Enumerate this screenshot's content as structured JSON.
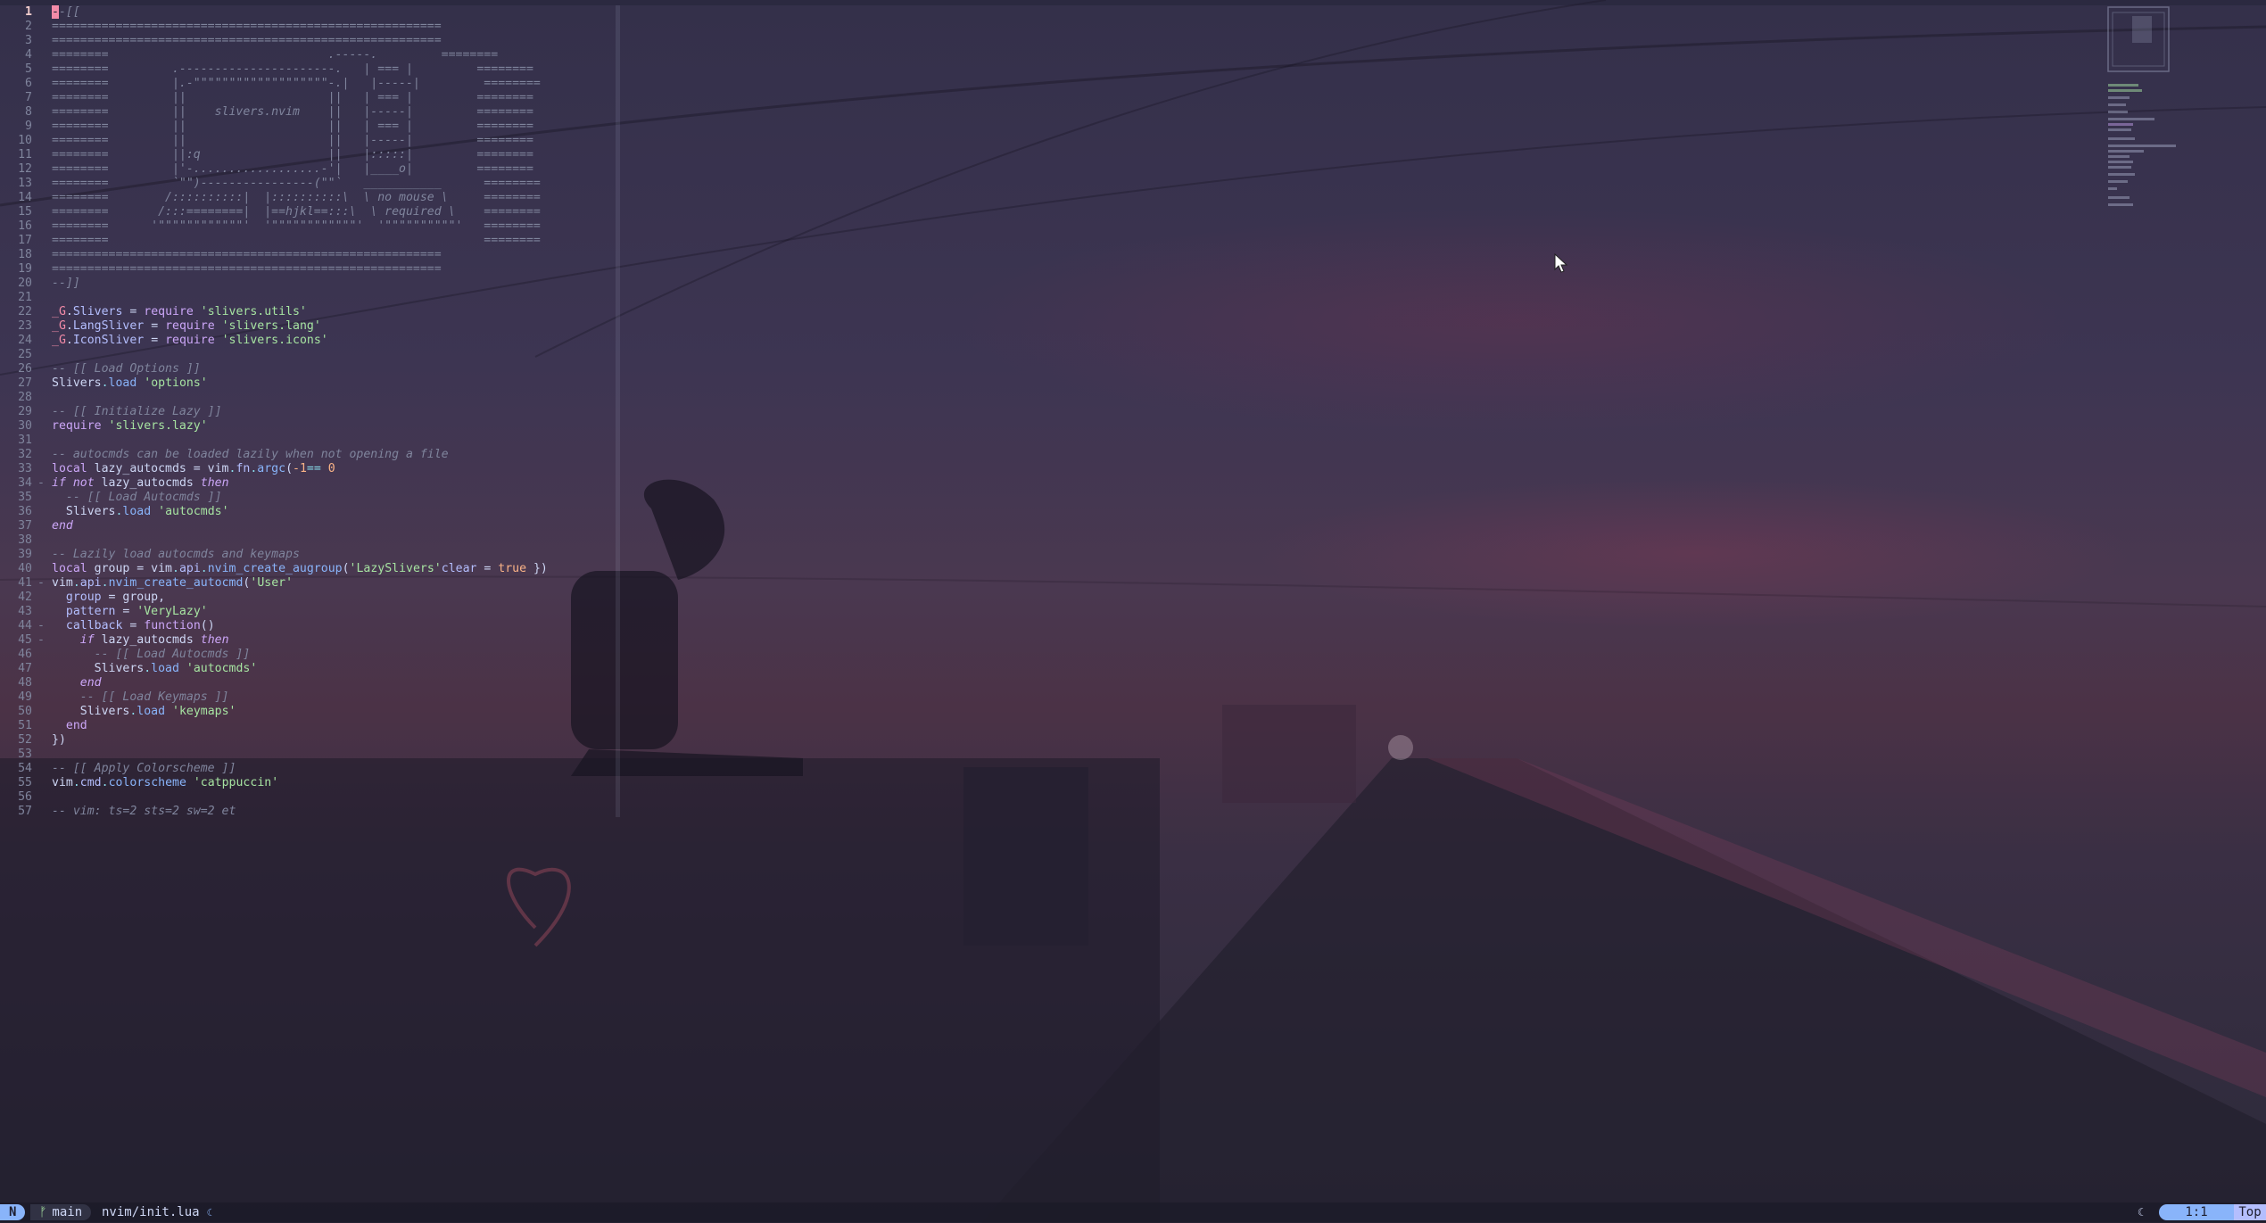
{
  "editor": {
    "lines": [
      {
        "n": "1",
        "segs": [
          [
            "cursor",
            "-"
          ],
          [
            "c-comment",
            "-[["
          ]
        ],
        "cur": true
      },
      {
        "n": "2",
        "segs": [
          [
            "c-comment",
            "======================================================="
          ]
        ]
      },
      {
        "n": "3",
        "segs": [
          [
            "c-comment",
            "======================================================="
          ]
        ]
      },
      {
        "n": "4",
        "segs": [
          [
            "c-comment",
            "========                               .-----.         ========"
          ]
        ]
      },
      {
        "n": "5",
        "segs": [
          [
            "c-comment",
            "========         .----------------------.   | === |         ========"
          ]
        ]
      },
      {
        "n": "6",
        "segs": [
          [
            "c-comment",
            "========         |.-\"\"\"\"\"\"\"\"\"\"\"\"\"\"\"\"\"\"\"-.|   |-----|         ========"
          ]
        ]
      },
      {
        "n": "7",
        "segs": [
          [
            "c-comment",
            "========         ||                    ||   | === |         ========"
          ]
        ]
      },
      {
        "n": "8",
        "segs": [
          [
            "c-comment",
            "========         ||    slivers.nvim    ||   |-----|         ========"
          ]
        ]
      },
      {
        "n": "9",
        "segs": [
          [
            "c-comment",
            "========         ||                    ||   | === |         ========"
          ]
        ]
      },
      {
        "n": "10",
        "segs": [
          [
            "c-comment",
            "========         ||                    ||   |-----|         ========"
          ]
        ]
      },
      {
        "n": "11",
        "segs": [
          [
            "c-comment",
            "========         ||:q                  ||   |:::::|         ========"
          ]
        ]
      },
      {
        "n": "12",
        "segs": [
          [
            "c-comment",
            "========         |'-..................-'|   |____o|         ========"
          ]
        ]
      },
      {
        "n": "13",
        "segs": [
          [
            "c-comment",
            "========         `\"\")----------------(\"\"`   ___________      ========"
          ]
        ]
      },
      {
        "n": "14",
        "segs": [
          [
            "c-comment",
            "========        /::::::::::|  |::::::::::\\  \\ no mouse \\     ========"
          ]
        ]
      },
      {
        "n": "15",
        "segs": [
          [
            "c-comment",
            "========       /:::========|  |==hjkl==:::\\  \\ required \\    ========"
          ]
        ]
      },
      {
        "n": "16",
        "segs": [
          [
            "c-comment",
            "========      '\"\"\"\"\"\"\"\"\"\"\"\"'  '\"\"\"\"\"\"\"\"\"\"\"\"'  '\"\"\"\"\"\"\"\"\"\"'   ========"
          ]
        ]
      },
      {
        "n": "17",
        "segs": [
          [
            "c-comment",
            "========                                                     ========"
          ]
        ]
      },
      {
        "n": "18",
        "segs": [
          [
            "c-comment",
            "======================================================="
          ]
        ]
      },
      {
        "n": "19",
        "segs": [
          [
            "c-comment",
            "======================================================="
          ]
        ]
      },
      {
        "n": "20",
        "segs": [
          [
            "c-comment",
            "--]]"
          ]
        ]
      },
      {
        "n": "21",
        "segs": []
      },
      {
        "n": "22",
        "segs": [
          [
            "c-g",
            "_G"
          ],
          [
            "",
            "."
          ],
          [
            "c-field",
            "Slivers"
          ],
          [
            "",
            " = "
          ],
          [
            "c-kw2",
            "require"
          ],
          [
            "",
            " "
          ],
          [
            "c-str",
            "'slivers.utils'"
          ]
        ]
      },
      {
        "n": "23",
        "segs": [
          [
            "c-g",
            "_G"
          ],
          [
            "",
            "."
          ],
          [
            "c-field",
            "LangSliver"
          ],
          [
            "",
            " = "
          ],
          [
            "c-kw2",
            "require"
          ],
          [
            "",
            " "
          ],
          [
            "c-str",
            "'slivers.lang'"
          ]
        ]
      },
      {
        "n": "24",
        "segs": [
          [
            "c-g",
            "_G"
          ],
          [
            "",
            "."
          ],
          [
            "c-field",
            "IconSliver"
          ],
          [
            "",
            " = "
          ],
          [
            "c-kw2",
            "require"
          ],
          [
            "",
            " "
          ],
          [
            "c-str",
            "'slivers.icons'"
          ]
        ]
      },
      {
        "n": "25",
        "segs": []
      },
      {
        "n": "26",
        "segs": [
          [
            "c-comment",
            "-- [[ Load Options ]]"
          ]
        ]
      },
      {
        "n": "27",
        "segs": [
          [
            "",
            "Slivers"
          ],
          [
            "c-op",
            "."
          ],
          [
            "c-fn",
            "load"
          ],
          [
            "",
            " "
          ],
          [
            "c-str",
            "'options'"
          ]
        ]
      },
      {
        "n": "28",
        "segs": []
      },
      {
        "n": "29",
        "segs": [
          [
            "c-comment",
            "-- [[ Initialize Lazy ]]"
          ]
        ]
      },
      {
        "n": "30",
        "segs": [
          [
            "c-kw2",
            "require"
          ],
          [
            "",
            " "
          ],
          [
            "c-str",
            "'slivers.lazy'"
          ]
        ]
      },
      {
        "n": "31",
        "segs": []
      },
      {
        "n": "32",
        "segs": [
          [
            "c-comment",
            "-- autocmds can be loaded lazily when not opening a file"
          ]
        ]
      },
      {
        "n": "33",
        "segs": [
          [
            "c-kw2",
            "local"
          ],
          [
            "",
            " lazy_autocmds = vim"
          ],
          [
            "c-op",
            "."
          ],
          [
            "c-field",
            "fn"
          ],
          [
            "c-op",
            "."
          ],
          [
            "c-fn",
            "argc"
          ],
          [
            "",
            "("
          ],
          [
            "c-num",
            "-1"
          ],
          [
            ") "
          ],
          [
            "c-op",
            "=="
          ],
          [
            "",
            " "
          ],
          [
            "c-num",
            "0"
          ]
        ]
      },
      {
        "n": "34",
        "fold": "-",
        "segs": [
          [
            "c-kw",
            "if"
          ],
          [
            "",
            " "
          ],
          [
            "c-kw",
            "not"
          ],
          [
            "",
            " lazy_autocmds "
          ],
          [
            "c-kw",
            "then"
          ]
        ]
      },
      {
        "n": "35",
        "segs": [
          [
            "",
            "  "
          ],
          [
            "c-comment",
            "-- [[ Load Autocmds ]]"
          ]
        ]
      },
      {
        "n": "36",
        "segs": [
          [
            "",
            "  Slivers"
          ],
          [
            "c-op",
            "."
          ],
          [
            "c-fn",
            "load"
          ],
          [
            "",
            " "
          ],
          [
            "c-str",
            "'autocmds'"
          ]
        ]
      },
      {
        "n": "37",
        "segs": [
          [
            "c-kw",
            "end"
          ]
        ]
      },
      {
        "n": "38",
        "segs": []
      },
      {
        "n": "39",
        "segs": [
          [
            "c-comment",
            "-- Lazily load autocmds and keymaps"
          ]
        ]
      },
      {
        "n": "40",
        "segs": [
          [
            "c-kw2",
            "local"
          ],
          [
            "",
            " group = vim"
          ],
          [
            "c-op",
            "."
          ],
          [
            "c-field",
            "api"
          ],
          [
            "c-op",
            "."
          ],
          [
            "c-fn",
            "nvim_create_augroup"
          ],
          [
            "",
            "("
          ],
          [
            "c-str",
            "'LazySlivers'"
          ],
          [
            ", { "
          ],
          [
            "c-field",
            "clear"
          ],
          [
            "",
            " = "
          ],
          [
            "c-bool",
            "true"
          ],
          [
            "",
            " })"
          ]
        ]
      },
      {
        "n": "41",
        "fold": "-",
        "segs": [
          [
            "",
            "vim"
          ],
          [
            "c-op",
            "."
          ],
          [
            "c-field",
            "api"
          ],
          [
            "c-op",
            "."
          ],
          [
            "c-fn",
            "nvim_create_autocmd"
          ],
          [
            "",
            "("
          ],
          [
            "c-str",
            "'User'"
          ],
          [
            ", {"
          ]
        ]
      },
      {
        "n": "42",
        "segs": [
          [
            "",
            "  "
          ],
          [
            "c-field",
            "group"
          ],
          [
            "",
            " = group,"
          ]
        ]
      },
      {
        "n": "43",
        "segs": [
          [
            "",
            "  "
          ],
          [
            "c-field",
            "pattern"
          ],
          [
            "",
            " = "
          ],
          [
            "c-str",
            "'VeryLazy'"
          ],
          [
            ","
          ]
        ]
      },
      {
        "n": "44",
        "fold": "-",
        "segs": [
          [
            "",
            "  "
          ],
          [
            "c-field",
            "callback"
          ],
          [
            "",
            " = "
          ],
          [
            "c-kw2",
            "function"
          ],
          [
            "",
            "()"
          ]
        ]
      },
      {
        "n": "45",
        "fold": "-",
        "segs": [
          [
            "",
            "    "
          ],
          [
            "c-kw",
            "if"
          ],
          [
            "",
            " lazy_autocmds "
          ],
          [
            "c-kw",
            "then"
          ]
        ]
      },
      {
        "n": "46",
        "segs": [
          [
            "",
            "      "
          ],
          [
            "c-comment",
            "-- [[ Load Autocmds ]]"
          ]
        ]
      },
      {
        "n": "47",
        "segs": [
          [
            "",
            "      Slivers"
          ],
          [
            "c-op",
            "."
          ],
          [
            "c-fn",
            "load"
          ],
          [
            "",
            " "
          ],
          [
            "c-str",
            "'autocmds'"
          ]
        ]
      },
      {
        "n": "48",
        "segs": [
          [
            "",
            "    "
          ],
          [
            "c-kw",
            "end"
          ]
        ]
      },
      {
        "n": "49",
        "segs": [
          [
            "",
            "    "
          ],
          [
            "c-comment",
            "-- [[ Load Keymaps ]]"
          ]
        ]
      },
      {
        "n": "50",
        "segs": [
          [
            "",
            "    Slivers"
          ],
          [
            "c-op",
            "."
          ],
          [
            "c-fn",
            "load"
          ],
          [
            "",
            " "
          ],
          [
            "c-str",
            "'keymaps'"
          ]
        ]
      },
      {
        "n": "51",
        "segs": [
          [
            "",
            "  "
          ],
          [
            "c-kw2",
            "end"
          ],
          [
            ","
          ]
        ]
      },
      {
        "n": "52",
        "segs": [
          [
            "",
            "})"
          ]
        ]
      },
      {
        "n": "53",
        "segs": []
      },
      {
        "n": "54",
        "segs": [
          [
            "c-comment",
            "-- [[ Apply Colorscheme ]]"
          ]
        ]
      },
      {
        "n": "55",
        "segs": [
          [
            "",
            "vim"
          ],
          [
            "c-op",
            "."
          ],
          [
            "c-field",
            "cmd"
          ],
          [
            "c-op",
            "."
          ],
          [
            "c-fn",
            "colorscheme"
          ],
          [
            "",
            " "
          ],
          [
            "c-str",
            "'catppuccin'"
          ]
        ]
      },
      {
        "n": "56",
        "segs": []
      },
      {
        "n": "57",
        "segs": [
          [
            "c-comment",
            "-- vim: ts=2 sts=2 sw=2 et"
          ]
        ]
      }
    ]
  },
  "statusline": {
    "mode": "N",
    "branch_icon": "ᚠ",
    "branch": "main",
    "file": "nvim/init.lua",
    "file_icon": "☾",
    "right_icon": "☾",
    "position": "1:1",
    "percent": "Top"
  },
  "icons": {
    "mouse": "pointer-arrow-icon",
    "minimap": "minimap"
  },
  "colors": {
    "accent": "#89b4fa",
    "lavender": "#b4befe",
    "string": "#a6e3a1",
    "keyword": "#cba6f7",
    "comment": "#7f849c"
  }
}
